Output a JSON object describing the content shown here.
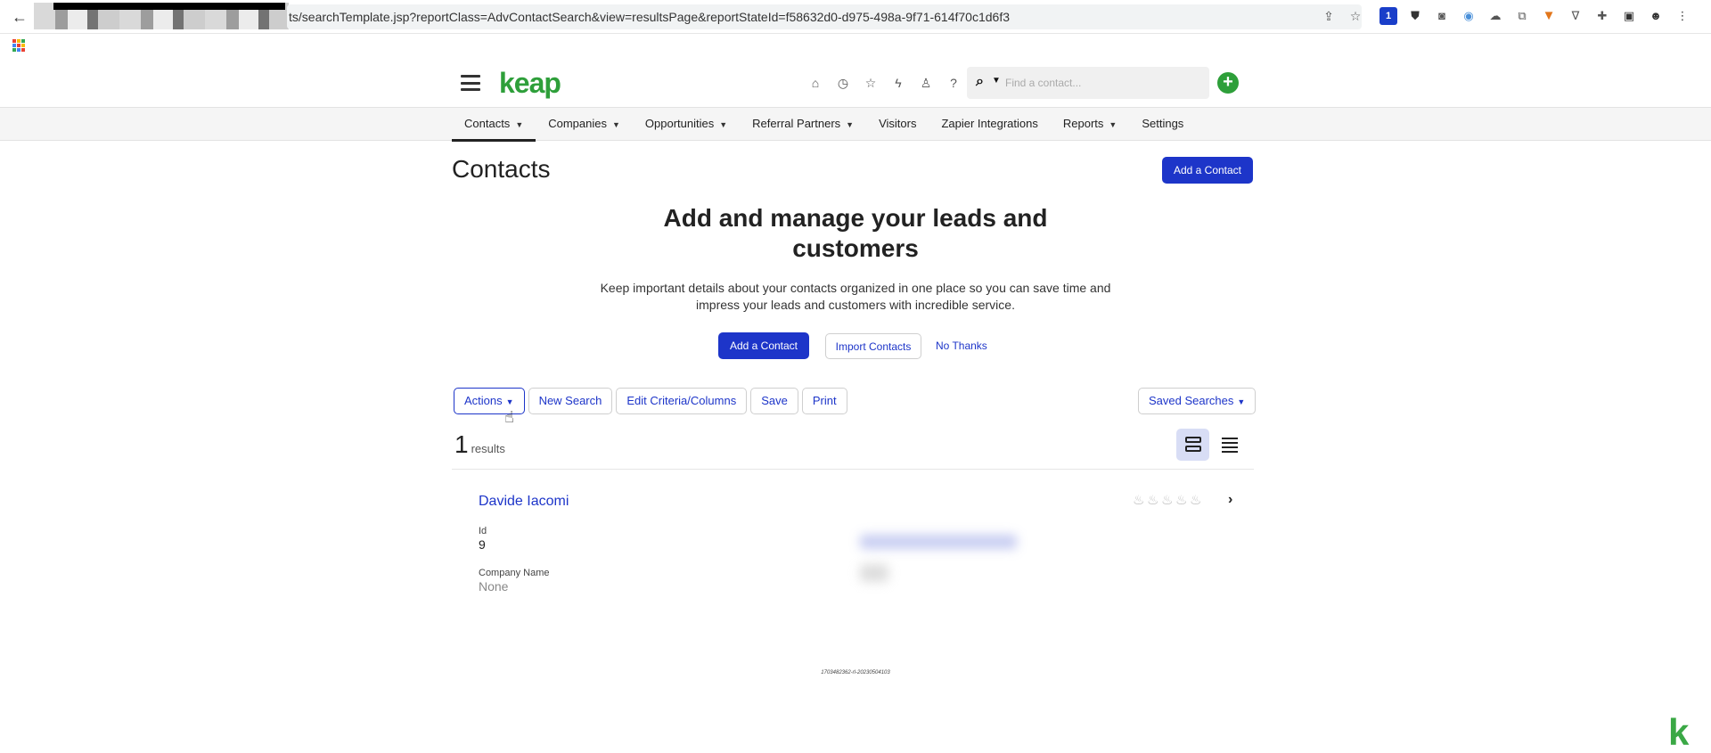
{
  "browser": {
    "url": "ts/searchTemplate.jsp?reportClass=AdvContactSearch&view=resultsPage&reportStateId=f58632d0-d975-498a-9f71-614f70c1d6f3",
    "ext_badge": "1"
  },
  "header": {
    "logo": "keap",
    "search_placeholder": "Find a contact..."
  },
  "tabs": [
    {
      "label": "Contacts",
      "caret": true,
      "active": true
    },
    {
      "label": "Companies",
      "caret": true
    },
    {
      "label": "Opportunities",
      "caret": true
    },
    {
      "label": "Referral Partners",
      "caret": true
    },
    {
      "label": "Visitors"
    },
    {
      "label": "Zapier Integrations"
    },
    {
      "label": "Reports",
      "caret": true
    },
    {
      "label": "Settings"
    }
  ],
  "page": {
    "title": "Contacts",
    "add_contact": "Add a Contact"
  },
  "hero": {
    "title": "Add and manage your leads and customers",
    "text": "Keep important details about your contacts organized in one place so you can save time and impress your leads and customers with incredible service.",
    "add_contact": "Add a Contact",
    "import_contacts": "Import Contacts",
    "no_thanks": "No Thanks"
  },
  "toolbar": {
    "actions": "Actions",
    "new_search": "New Search",
    "edit_criteria": "Edit Criteria/Columns",
    "save": "Save",
    "print": "Print",
    "saved_searches": "Saved Searches"
  },
  "results": {
    "count": "1",
    "label": "results"
  },
  "contact": {
    "name": "Davide Iacomi",
    "id_label": "Id",
    "id_value": "9",
    "company_label": "Company Name",
    "company_value": "None",
    "score": 0
  },
  "footer": {
    "build": "1703482362-rl-20230504103"
  }
}
